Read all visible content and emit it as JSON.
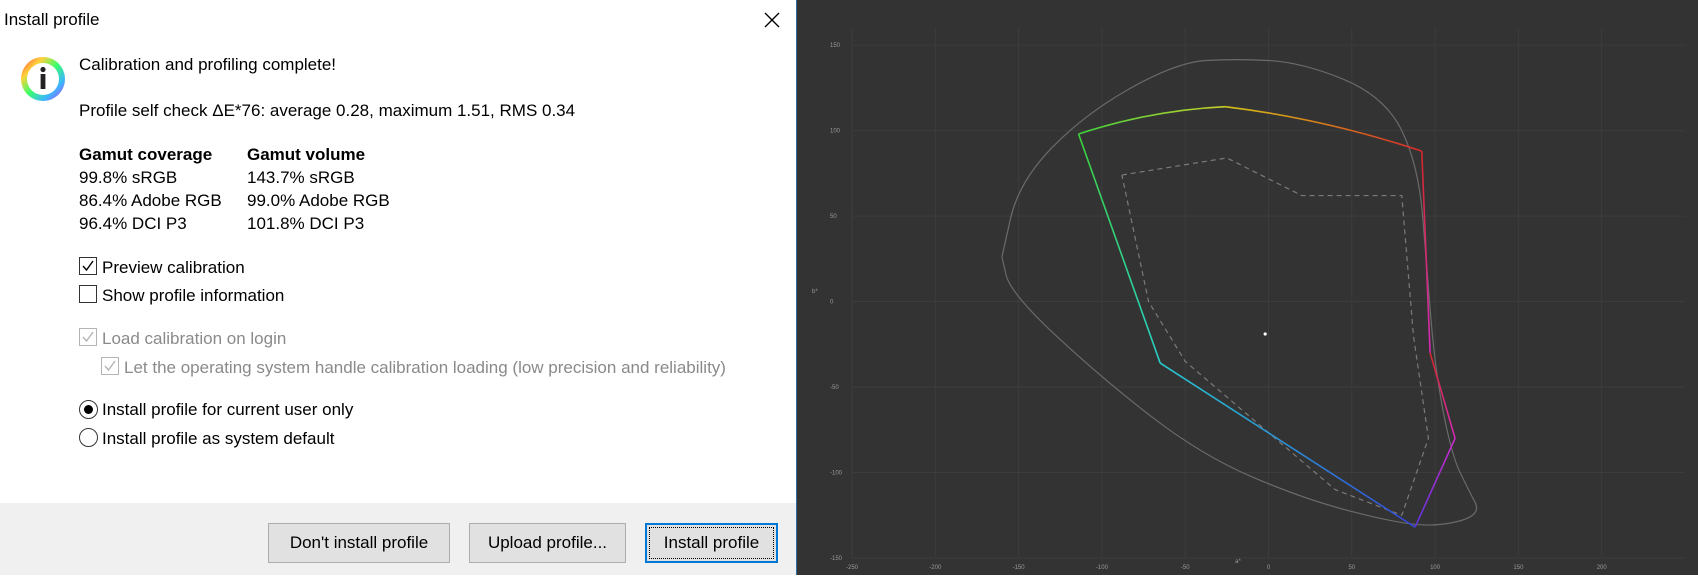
{
  "window": {
    "title": "Install profile"
  },
  "message": {
    "heading": "Calibration and profiling complete!",
    "selfcheck": "Profile self check ΔE*76: average 0.28, maximum 1.51, RMS 0.34"
  },
  "gamut": {
    "coverage_header": "Gamut coverage",
    "volume_header": "Gamut volume",
    "coverage": [
      "99.8% sRGB",
      "86.4% Adobe RGB",
      "96.4% DCI P3"
    ],
    "volume": [
      "143.7% sRGB",
      "99.0% Adobe RGB",
      "101.8% DCI P3"
    ]
  },
  "options": {
    "preview_calibration": {
      "label": "Preview calibration",
      "checked": true
    },
    "show_profile_info": {
      "label": "Show profile information",
      "checked": false
    },
    "load_on_login": {
      "label": "Load calibration on login",
      "checked": true,
      "disabled": true
    },
    "os_handle": {
      "label": "Let the operating system handle calibration loading (low precision and reliability)",
      "checked": true,
      "disabled": true
    }
  },
  "install_scope": {
    "current_user": {
      "label": "Install profile for current user only",
      "selected": true
    },
    "system_default": {
      "label": "Install profile as system default",
      "selected": false
    }
  },
  "buttons": {
    "dont_install": "Don't install profile",
    "upload": "Upload profile...",
    "install": "Install profile"
  },
  "chart_data": {
    "type": "line",
    "xlabel": "a*",
    "ylabel": "b*",
    "xlim": [
      -250,
      250
    ],
    "ylim": [
      -150,
      160
    ],
    "x_ticks": [
      -250,
      -200,
      -150,
      -100,
      -50,
      0,
      50,
      100,
      150,
      200
    ],
    "y_ticks": [
      150,
      100,
      50,
      0,
      -50,
      -100,
      -150
    ],
    "grid": true,
    "series": [
      {
        "style": "solid-gray",
        "points": [
          [
            -160,
            26
          ],
          [
            -150,
            70
          ],
          [
            -110,
            110
          ],
          [
            -55,
            140
          ],
          [
            -20,
            142
          ],
          [
            20,
            140
          ],
          [
            70,
            120
          ],
          [
            90,
            80
          ],
          [
            95,
            20
          ],
          [
            100,
            -40
          ],
          [
            110,
            -90
          ],
          [
            120,
            -110
          ],
          [
            128,
            -125
          ],
          [
            100,
            -132
          ],
          [
            70,
            -128
          ],
          [
            20,
            -115
          ],
          [
            -40,
            -90
          ],
          [
            -100,
            -45
          ],
          [
            -155,
            5
          ],
          [
            -160,
            26
          ]
        ]
      },
      {
        "style": "dashed-gray",
        "points": [
          [
            -88,
            74
          ],
          [
            -25,
            84
          ],
          [
            20,
            62
          ],
          [
            80,
            62
          ],
          [
            87,
            -20
          ],
          [
            96,
            -80
          ],
          [
            80,
            -125
          ],
          [
            40,
            -110
          ],
          [
            -50,
            -35
          ],
          [
            -72,
            0
          ],
          [
            -88,
            74
          ]
        ]
      },
      {
        "style": "gamut-colored",
        "points": [
          [
            -114,
            98
          ],
          [
            -26,
            114
          ],
          [
            92,
            88
          ],
          [
            97,
            -30
          ],
          [
            112,
            -80
          ],
          [
            88,
            -132
          ],
          [
            -65,
            -36
          ],
          [
            -114,
            98
          ]
        ]
      }
    ],
    "white_point": [
      -2,
      -19
    ]
  }
}
